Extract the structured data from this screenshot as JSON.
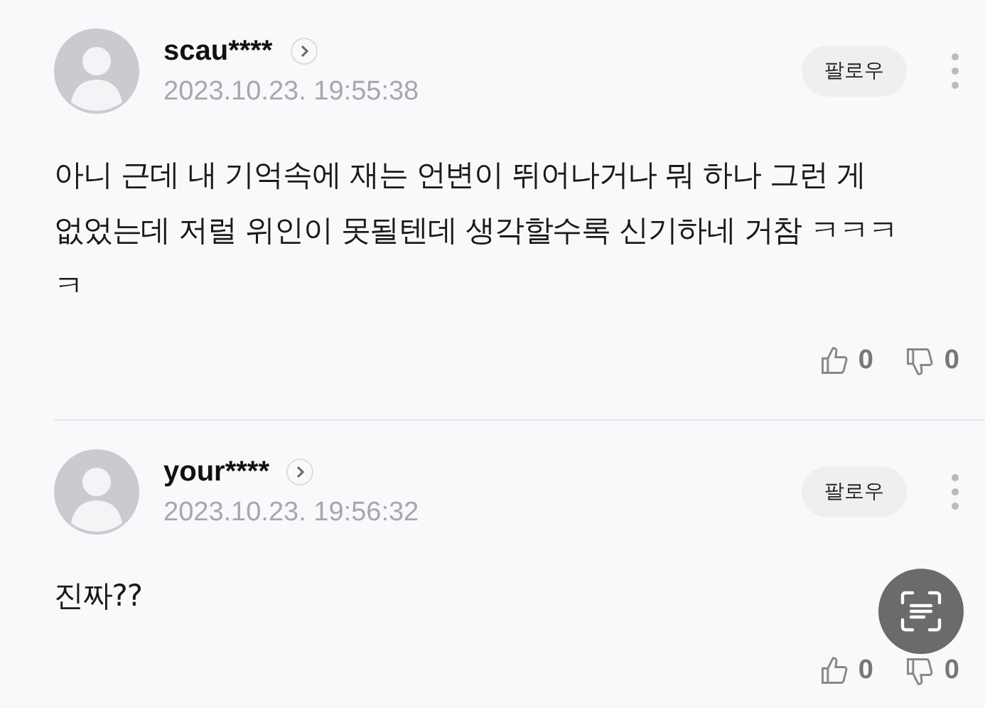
{
  "comments": [
    {
      "author": "scau****",
      "time": "2023.10.23. 19:55:38",
      "follow": "팔로우",
      "body": "아니 근데 내 기억속에 재는 언변이 뛰어나거나 뭐 하나 그런 게 없었는데 저럴 위인이 못될텐데 생각할수록 신기하네 거참 ㅋㅋㅋㅋ",
      "likes": "0",
      "dislikes": "0"
    },
    {
      "author": "your****",
      "time": "2023.10.23. 19:56:32",
      "follow": "팔로우",
      "body": "진짜??",
      "likes": "0",
      "dislikes": "0"
    }
  ]
}
